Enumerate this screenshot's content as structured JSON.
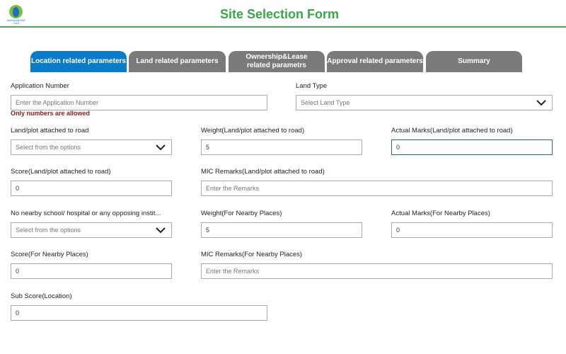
{
  "header": {
    "logo_text": "MAHANAGAR GAS",
    "title": "Site Selection Form"
  },
  "tabs": [
    {
      "label": "Location related parameters",
      "active": true
    },
    {
      "label": "Land related parameters"
    },
    {
      "label": "Ownership&Lease related parametrs"
    },
    {
      "label": "Approval related parameters"
    },
    {
      "label": "Summary"
    }
  ],
  "form": {
    "application_number": {
      "label": "Application Number",
      "placeholder": "Enter the Application Number",
      "error": "Only numbers are allowed"
    },
    "land_type": {
      "label": "Land Type",
      "placeholder": "Select Land Type"
    },
    "road": {
      "label": "Land/plot attached to road",
      "placeholder": "Select from the options"
    },
    "weight_road": {
      "label": "Weight(Land/plot attached to road)",
      "value": "5"
    },
    "actual_road": {
      "label": "Actual Marks(Land/plot attached to road)",
      "value": "0"
    },
    "score_road": {
      "label": "Score(Land/plot attached to road)",
      "value": "0"
    },
    "mic_road": {
      "label": "MIC Remarks(Land/plot attached to road)",
      "placeholder": "Enter the Remarks"
    },
    "nearby": {
      "label": "No nearby school/ hospital or any opposing instit...",
      "placeholder": "Select from the options"
    },
    "weight_nearby": {
      "label": "Weight(For Nearby Places)",
      "value": "5"
    },
    "actual_nearby": {
      "label": "Actual Marks(For Nearby Places)",
      "value": "0"
    },
    "score_nearby": {
      "label": "Score(For Nearby Places)",
      "value": "0"
    },
    "mic_nearby": {
      "label": "MIC Remarks(For Nearby Places)",
      "placeholder": "Enter the Remarks"
    },
    "sub_score": {
      "label": "Sub Score(Location)",
      "value": "0"
    }
  }
}
